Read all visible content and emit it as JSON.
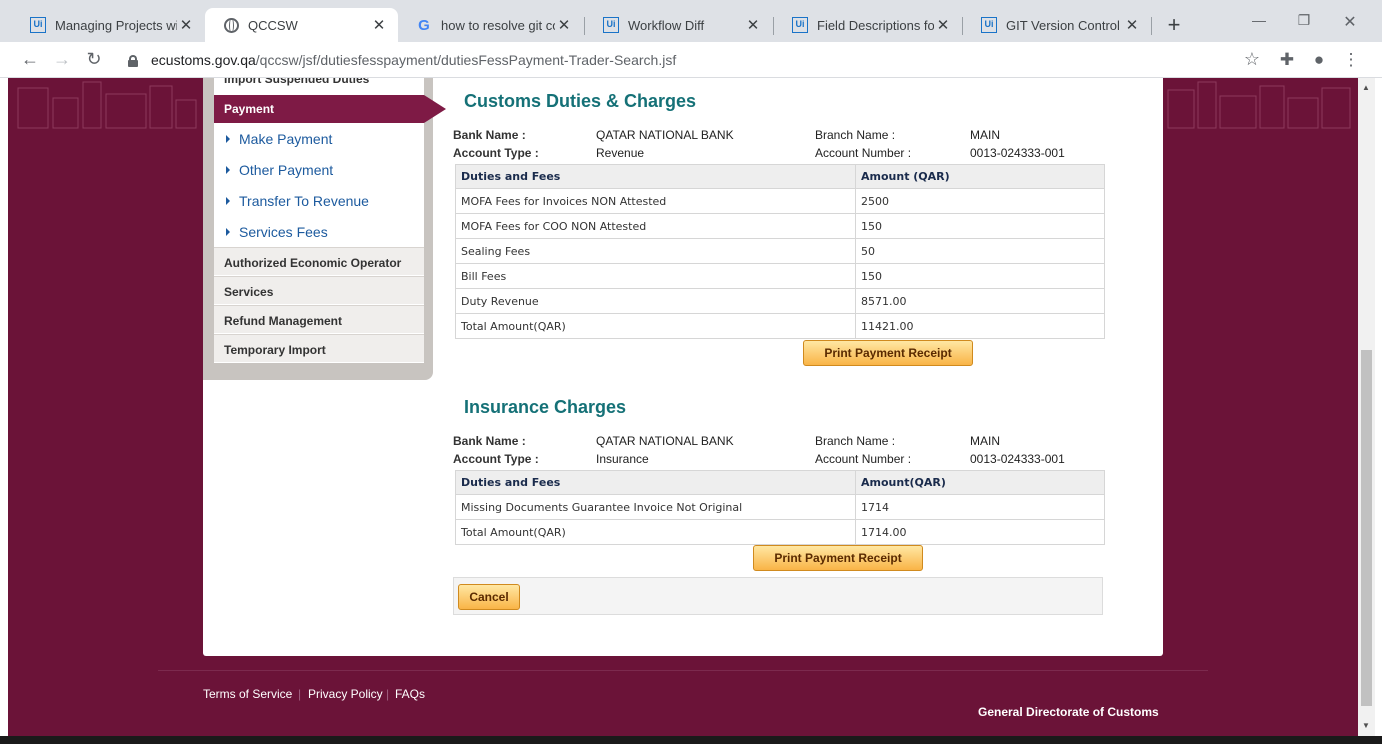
{
  "browser": {
    "tabs": [
      {
        "title": "Managing Projects with",
        "icon": "uipath-icon"
      },
      {
        "title": "QCCSW",
        "icon": "globe-icon"
      },
      {
        "title": "how to resolve git confl",
        "icon": "google-icon"
      },
      {
        "title": "Workflow Diff",
        "icon": "uipath-icon"
      },
      {
        "title": "Field Descriptions for G",
        "icon": "uipath-icon"
      },
      {
        "title": "GIT Version Control",
        "icon": "uipath-icon"
      }
    ],
    "url_host": "ecustoms.gov.qa",
    "url_path": "/qccsw/jsf/dutiesfesspayment/dutiesFessPayment-Trader-Search.jsf"
  },
  "sidebar": {
    "partial_item": "Import Suspended Duties",
    "active": "Payment",
    "subitems": [
      "Make Payment",
      "Other Payment",
      "Transfer To Revenue",
      "Services Fees"
    ],
    "items": [
      "Authorized Economic Operator",
      "Services",
      "Refund Management",
      "Temporary Import"
    ]
  },
  "customs": {
    "title": "Customs Duties & Charges",
    "bank_name_label": "Bank Name :",
    "bank_name": "QATAR NATIONAL BANK",
    "branch_label": "Branch Name :",
    "branch": "MAIN",
    "account_type_label": "Account Type :",
    "account_type": "Revenue",
    "account_number_label": "Account Number :",
    "account_number": "0013-024333-001",
    "col_duties": "Duties and Fees",
    "col_amount": "Amount (QAR)",
    "rows": [
      {
        "name": "MOFA Fees for Invoices NON Attested",
        "amount": "2500"
      },
      {
        "name": "MOFA Fees for COO NON Attested",
        "amount": "150"
      },
      {
        "name": "Sealing Fees",
        "amount": "50"
      },
      {
        "name": "Bill Fees",
        "amount": "150"
      },
      {
        "name": "Duty Revenue",
        "amount": "8571.00"
      },
      {
        "name": "Total Amount(QAR)",
        "amount": "11421.00"
      }
    ],
    "print_label": "Print Payment Receipt"
  },
  "insurance": {
    "title": "Insurance Charges",
    "bank_name_label": "Bank Name :",
    "bank_name": "QATAR NATIONAL BANK",
    "branch_label": "Branch Name :",
    "branch": "MAIN",
    "account_type_label": "Account Type :",
    "account_type": "Insurance",
    "account_number_label": "Account Number :",
    "account_number": "0013-024333-001",
    "col_duties": "Duties and Fees",
    "col_amount": "Amount(QAR)",
    "rows": [
      {
        "name": "Missing Documents Guarantee Invoice Not Original",
        "amount": "1714"
      },
      {
        "name": "Total Amount(QAR)",
        "amount": "1714.00"
      }
    ],
    "print_label": "Print Payment Receipt"
  },
  "cancel_label": "Cancel",
  "footer": {
    "terms": "Terms of Service",
    "privacy": "Privacy Policy",
    "faqs": "FAQs",
    "org": "General Directorate of Customs"
  },
  "colors": {
    "brand_maroon": "#6b1338",
    "active_nav": "#7e1a45",
    "section_title": "#157177",
    "button_orange": "#f9b447"
  }
}
